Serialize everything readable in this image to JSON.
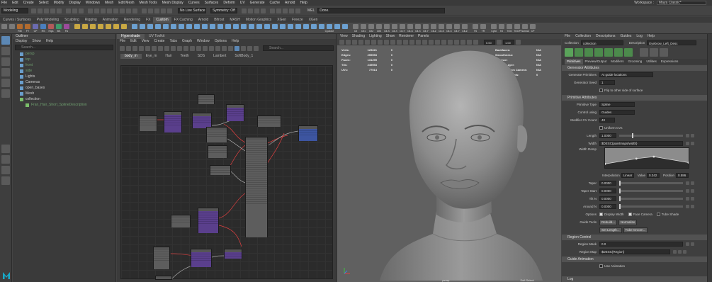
{
  "menubar": {
    "items": [
      "File",
      "Edit",
      "Create",
      "Select",
      "Modify",
      "Display",
      "Windows",
      "Mesh",
      "Edit Mesh",
      "Mesh Tools",
      "Mesh Display",
      "Curves",
      "Surfaces",
      "Deform",
      "UV",
      "Generate",
      "Cache",
      "Arnold",
      "Help"
    ],
    "workspace_label": "Workspace :",
    "workspace_value": "Maya Classic*"
  },
  "statusline": {
    "mode": "Modeling",
    "live_surface": "No Live Surface",
    "symmetry": "Symmetry: Off",
    "mel_label": "MEL",
    "mel_output": "Done."
  },
  "shelf": {
    "tabs": [
      "Curves / Surfaces",
      "Poly Modeling",
      "Sculpting",
      "Rigging",
      "Animation",
      "Rendering",
      "FX",
      "Custom",
      "FX Caching",
      "Arnold",
      "Bifrost",
      "MASH",
      "Motion Graphics",
      "XGen",
      "Freeze",
      "XGen"
    ],
    "active_tab": "Custom",
    "items": [
      {
        "label": "",
        "color": "#7a7a7a"
      },
      {
        "label": "",
        "color": "#7a7a7a"
      },
      {
        "label": "RM",
        "color": "#b36b2e"
      },
      {
        "label": "FT",
        "color": "#b36b2e"
      },
      {
        "label": "CP",
        "color": "#6b6bb0"
      },
      {
        "label": "RS",
        "color": "#4a7fbf"
      },
      {
        "label": "Hips",
        "color": "#b35a5a"
      },
      {
        "label": "BS",
        "color": "#3d9b6a"
      },
      {
        "label": "FA",
        "color": "#9c4b9c"
      },
      {
        "label": "",
        "color": "#c9a843"
      },
      {
        "label": "",
        "color": "#c9a843"
      },
      {
        "label": "",
        "color": "#c9a843"
      },
      {
        "label": "",
        "color": "#c9a843"
      },
      {
        "label": "",
        "color": "#c9a843"
      },
      {
        "label": "",
        "color": "#c9a843"
      },
      {
        "label": "",
        "color": "#c9a843"
      },
      {
        "label": "",
        "color": "#6ca0d0"
      },
      {
        "label": "",
        "color": "#6ca0d0"
      },
      {
        "label": "",
        "color": "#6ca0d0"
      },
      {
        "label": "",
        "color": "#6ca0d0"
      },
      {
        "label": "",
        "color": "#6ca0d0"
      },
      {
        "label": "",
        "color": "#6ca0d0"
      },
      {
        "label": "",
        "color": "#6ca0d0"
      },
      {
        "label": "",
        "color": "#6ca0d0"
      },
      {
        "label": "",
        "color": "#6ca0d0"
      },
      {
        "label": "",
        "color": "#6ca0d0"
      },
      {
        "label": "",
        "color": "#6ca0d0"
      },
      {
        "label": "",
        "color": "#6ca0d0"
      },
      {
        "label": "",
        "color": "#6ca0d0"
      },
      {
        "label": "",
        "color": "#6ca0d0"
      },
      {
        "label": "",
        "color": "#6ca0d0"
      },
      {
        "label": "",
        "color": "#6ca0d0"
      },
      {
        "label": "",
        "color": "#6ca0d0"
      },
      {
        "label": "",
        "color": "#6ca0d0"
      },
      {
        "label": "",
        "color": "#6ca0d0"
      },
      {
        "label": "",
        "color": "#6ca0d0"
      },
      {
        "label": "",
        "color": "#6ca0d0"
      },
      {
        "label": "",
        "color": "#6ca0d0"
      },
      {
        "label": "",
        "color": "#6ca0d0"
      },
      {
        "label": "",
        "color": "#6ca0d0"
      },
      {
        "label": "",
        "color": "#6ca0d0"
      },
      {
        "label": "Cyclone",
        "color": "#6ca0d0"
      },
      {
        "label": "",
        "color": "#6ca0d0"
      },
      {
        "label": "",
        "color": "#6ca0d0"
      },
      {
        "label": "Clt",
        "color": "#7a7a7a"
      },
      {
        "label": "Clt1",
        "color": "#7a7a7a"
      },
      {
        "label": "Clt2",
        "color": "#7a7a7a"
      },
      {
        "label": "Clt3",
        "color": "#7a7a7a"
      },
      {
        "label": "Clt-S",
        "color": "#7a7a7a"
      },
      {
        "label": "Clt-X",
        "color": "#7a7a7a"
      },
      {
        "label": "Clt-Y",
        "color": "#7a7a7a"
      },
      {
        "label": "Clt-S",
        "color": "#7a7a7a"
      },
      {
        "label": "Clt-X",
        "color": "#7a7a7a"
      },
      {
        "label": "Clt-Y",
        "color": "#7a7a7a"
      },
      {
        "label": "Clt-Z",
        "color": "#7a7a7a"
      },
      {
        "label": "Clt-S",
        "color": "#7a7a7a"
      },
      {
        "label": "Clt-X",
        "color": "#7a7a7a"
      },
      {
        "label": "Clt-Y",
        "color": "#7a7a7a"
      },
      {
        "label": "Clt-Z",
        "color": "#7a7a7a"
      },
      {
        "label": "TS",
        "color": "#7a7a7a"
      },
      {
        "label": "TR",
        "color": "#7a7a7a"
      },
      {
        "label": "Cpfd",
        "color": "#7a7a7a"
      },
      {
        "label": "HJ",
        "color": "#7a7a7a"
      },
      {
        "label": "TOO",
        "color": "#7a7a7a"
      },
      {
        "label": "TOOP",
        "color": "#7a7a7a"
      },
      {
        "label": "Normal",
        "color": "#7a7a7a"
      },
      {
        "label": "CP",
        "color": "#7a7a7a"
      }
    ]
  },
  "outliner": {
    "title": "Outliner",
    "menu": [
      "Display",
      "Show",
      "Help"
    ],
    "search_placeholder": "Search...",
    "items": [
      {
        "label": "persp",
        "dim": true
      },
      {
        "label": "top",
        "dim": true
      },
      {
        "label": "front",
        "dim": true
      },
      {
        "label": "side",
        "dim": true
      },
      {
        "label": "Lights",
        "dim": false
      },
      {
        "label": "Cameras",
        "dim": false
      },
      {
        "label": "open_bases",
        "dim": false
      },
      {
        "label": "Mesh",
        "dim": false
      },
      {
        "label": "collection",
        "dim": false
      },
      {
        "label": "Fran_Hair_Short_SplineDescription",
        "dim": true,
        "sub": true
      }
    ]
  },
  "hypershade": {
    "title": "Hypershade",
    "title2": "UV Toolkit",
    "menu": [
      "File",
      "Edit",
      "View",
      "Create",
      "Tabs",
      "Graph",
      "Window",
      "Options",
      "Help"
    ],
    "search_placeholder": "Search...",
    "tabs": [
      "body_m",
      "Eye_m",
      "Hair",
      "Teeth",
      "SDS",
      "Lambert",
      "SoftBody_1"
    ],
    "active_tab": "body_m"
  },
  "viewport": {
    "menu": [
      "View",
      "Shading",
      "Lighting",
      "Show",
      "Renderer",
      "Panels"
    ],
    "hud_left_labels": [
      "Verts:",
      "Edges:",
      "Faces:",
      "Tris:",
      "UVs:"
    ],
    "hud_left_values": [
      "129221",
      "259053",
      "131295",
      "249053",
      "77014"
    ],
    "hud_left_zeros": [
      "0",
      "0",
      "0",
      "0",
      "0"
    ],
    "hud_right_labels": [
      "Backfaces:",
      "Smoothness:",
      "Instance:",
      "Display Layer:",
      "Distance From Camera:",
      "Selected Objects:"
    ],
    "hud_right_values": [
      "N/A",
      "N/A",
      "N/A",
      "N/A",
      "N/A",
      "0"
    ],
    "numbox1": "0.00",
    "numbox2": "1.00",
    "camera": "persp",
    "soft_select": "Soft Select"
  },
  "attr": {
    "tabs": [
      "File",
      "Collection",
      "Descriptions",
      "Guides",
      "Log",
      "Help"
    ],
    "collection_label": "Collection",
    "collection_value": "collection",
    "description_label": "Description",
    "description_value": "Eyebrow_Left_Desc",
    "subtabs": [
      "Primitives",
      "Preview/Output",
      "Modifiers",
      "Grooming",
      "Utilities",
      "Expressions"
    ],
    "generator_section": "Generator Attributes",
    "generate_primitives_label": "Generate Primitives",
    "generate_primitives_value": "At guide locations",
    "generator_seed_label": "Generator Seed",
    "generator_seed_value": "1",
    "flip_label": "Flip to other side of surface",
    "primitive_section": "Primitive Attributes",
    "primitive_type_label": "Primitive Type",
    "primitive_type_value": "Spline",
    "control_using_label": "Control using",
    "control_using_value": "Guides",
    "modifier_cv_label": "Modifier CV Count",
    "modifier_cv_value": "40",
    "uniform_cvs_label": "Uniform CVs",
    "length_label": "Length",
    "length_value": "1.0000",
    "width_label": "Width",
    "width_value": "$DESC{paintmaps/width}",
    "width_ramp_label": "Width Ramp",
    "interpolation_label": "Interpolation",
    "interpolation_value": "Linear",
    "value_label": "Value",
    "value_value": "0.342",
    "position_label": "Position",
    "position_value": "0.586",
    "taper_label": "Taper",
    "taper_value": "0.0000",
    "taper_start_label": "Taper Start",
    "taper_start_value": "0.0000",
    "tilt_label": "Tilt N",
    "tilt_value": "0.0000",
    "around_label": "Around N",
    "around_value": "0.0000",
    "options_label": "Options",
    "display_width_label": "Display Width",
    "face_camera_label": "Face Camera",
    "tube_shade_label": "Tube Shade",
    "guide_tools_label": "Guide Tools",
    "rebuild_btn": "Rebuild...",
    "normalize_btn": "Normalize",
    "set_length_btn": "Set Length...",
    "tube_groom_btn": "Tube Groom...",
    "region_section": "Region Control",
    "region_mask_label": "Region Mask",
    "region_mask_value": "0.0",
    "region_map_label": "Region Map",
    "region_map_value": "$DESC{Region}",
    "guide_anim_section": "Guide Animation",
    "use_anim_label": "Use Animation",
    "log_label": "Log"
  }
}
